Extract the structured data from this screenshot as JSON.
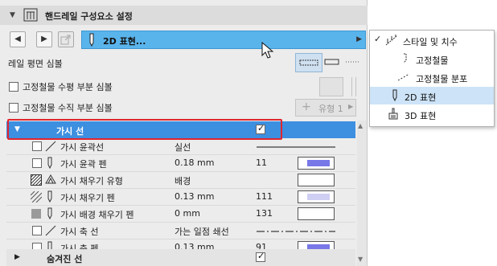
{
  "panel": {
    "title": "핸드레일 구성요소 설정",
    "dropdown_label": "2D 표현...",
    "row_rail_plan_symbol": "레일 평면 심볼",
    "row_horizontal": "고정철물 수평 부분 심볼",
    "row_vertical": "고정철물 수직 부분 심볼",
    "type_button": "유형 1"
  },
  "table": {
    "group_visible": {
      "name": "가시 선",
      "checked": true
    },
    "rows": [
      {
        "name": "가시 윤곽선",
        "value": "실선",
        "num": "",
        "line": "solid"
      },
      {
        "name": "가시 윤곽 펜",
        "value": "0.18 mm",
        "num": "11",
        "swatch_color": "#7878e8"
      },
      {
        "name": "가시 채우기 유형",
        "value": "배경",
        "num": "",
        "swatch_color": ""
      },
      {
        "name": "가시 채우기 펜",
        "value": "0.13 mm",
        "num": "111",
        "swatch_color": "#cfcff4"
      },
      {
        "name": "가시 배경 채우기 펜",
        "value": "0 mm",
        "num": "131",
        "swatch_color": ""
      },
      {
        "name": "가시 축 선",
        "value": "가는 일점 쇄선",
        "num": "",
        "line": "dashdot"
      },
      {
        "name": "가시 축 펜",
        "value": "0.13 mm",
        "num": "91",
        "swatch_color": "#7878e8"
      }
    ],
    "group_hidden": {
      "name": "숨겨진 선",
      "checked": true
    }
  },
  "popup": {
    "items": [
      {
        "label": "스타일 및 치수",
        "checked": true
      },
      {
        "label": "고정철물"
      },
      {
        "label": "고정철물 분포"
      },
      {
        "label": "2D 표현",
        "selected": true
      },
      {
        "label": "3D 표현"
      }
    ]
  },
  "colors": {
    "selection": "#3d8fe0",
    "dropdown": "#5ab4ec",
    "highlight_box": "#e0262e"
  }
}
